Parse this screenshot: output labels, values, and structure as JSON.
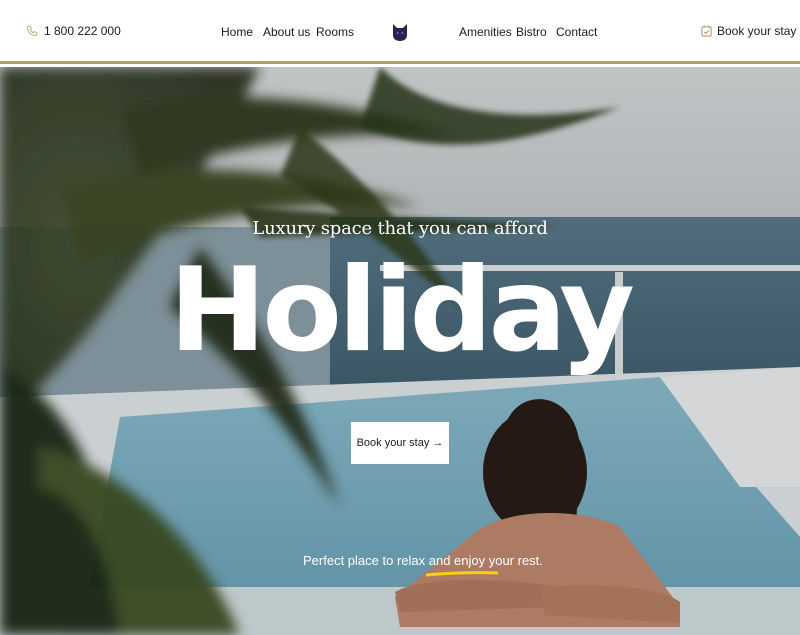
{
  "header": {
    "phone": "1 800 222 000",
    "nav_left": [
      "Home",
      "About us",
      "Rooms"
    ],
    "nav_right": [
      "Amenities",
      "Bistro",
      "Contact"
    ],
    "book_label": "Book your stay"
  },
  "hero": {
    "tagline": "Luxury space that you can afford",
    "headline": "Holiday",
    "button_label": "Book your stay →",
    "subline": "Perfect place to relax and enjoy your rest."
  },
  "colors": {
    "accent_border": "#b89a6e",
    "highlight": "#f2d21b",
    "logo": "#2a2350"
  },
  "icons": [
    "phone-icon",
    "cat-logo-icon",
    "calendar-check-icon"
  ]
}
